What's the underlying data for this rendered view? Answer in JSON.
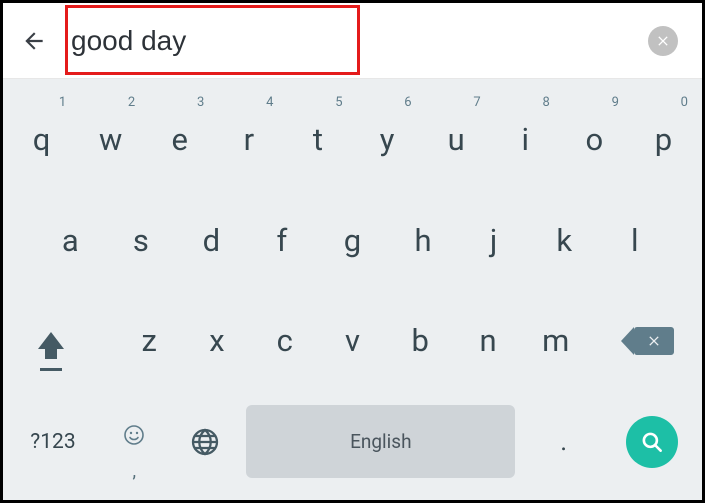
{
  "search": {
    "value": "good day",
    "placeholder": ""
  },
  "keyboard": {
    "row1": [
      {
        "letter": "q",
        "num": "1"
      },
      {
        "letter": "w",
        "num": "2"
      },
      {
        "letter": "e",
        "num": "3"
      },
      {
        "letter": "r",
        "num": "4"
      },
      {
        "letter": "t",
        "num": "5"
      },
      {
        "letter": "y",
        "num": "6"
      },
      {
        "letter": "u",
        "num": "7"
      },
      {
        "letter": "i",
        "num": "8"
      },
      {
        "letter": "o",
        "num": "9"
      },
      {
        "letter": "p",
        "num": "0"
      }
    ],
    "row2": [
      {
        "letter": "a"
      },
      {
        "letter": "s"
      },
      {
        "letter": "d"
      },
      {
        "letter": "f"
      },
      {
        "letter": "g"
      },
      {
        "letter": "h"
      },
      {
        "letter": "j"
      },
      {
        "letter": "k"
      },
      {
        "letter": "l"
      }
    ],
    "row3": [
      {
        "letter": "z"
      },
      {
        "letter": "x"
      },
      {
        "letter": "c"
      },
      {
        "letter": "v"
      },
      {
        "letter": "b"
      },
      {
        "letter": "n"
      },
      {
        "letter": "m"
      }
    ],
    "symbols_label": "?123",
    "space_label": "English",
    "period": ".",
    "emoji_comma": ","
  }
}
